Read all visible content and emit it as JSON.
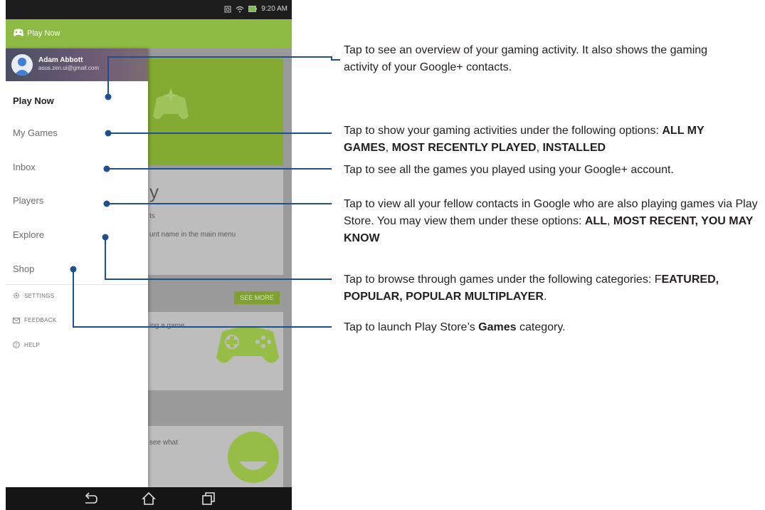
{
  "status_bar": {
    "time": "9:20 AM"
  },
  "app": {
    "title": "Play Now"
  },
  "account": {
    "name": "Adam Abbott",
    "email": "asus.zen.ui@gmail.com"
  },
  "nav": [
    {
      "label": "Play Now",
      "active": true
    },
    {
      "label": "My Games"
    },
    {
      "label": "Inbox"
    },
    {
      "label": "Players"
    },
    {
      "label": "Explore"
    },
    {
      "label": "Shop"
    }
  ],
  "secondary": [
    {
      "label": "SETTINGS",
      "icon": "gear-icon"
    },
    {
      "label": "FEEDBACK",
      "icon": "mail-icon"
    },
    {
      "label": "HELP",
      "icon": "help-icon"
    }
  ],
  "background": {
    "card_text_1": "y",
    "card_text_2": "ts",
    "card_text_3": "unt name in the main menu",
    "see_more": "SEE MORE",
    "card_text_4": "ing a game",
    "card_text_5": "see what"
  },
  "callouts": [
    {
      "parts": [
        {
          "t": "Tap to see an overview of your gaming activity. It also shows the gaming activity of your  Google+ contacts."
        }
      ]
    },
    {
      "parts": [
        {
          "t": "Tap to show your gaming activities under the following options: "
        },
        {
          "t": "ALL MY GAMES",
          "b": true
        },
        {
          "t": ", "
        },
        {
          "t": "MOST RECENTLY PLAYED",
          "b": true
        },
        {
          "t": ", "
        },
        {
          "t": "INSTALLED",
          "b": true
        }
      ]
    },
    {
      "parts": [
        {
          "t": "Tap to see all the games you played using your Google+ account."
        }
      ]
    },
    {
      "parts": [
        {
          "t": "Tap to view all your fellow contacts in Google who are also playing games via Play Store. You may view them under these options: "
        },
        {
          "t": "ALL",
          "b": true
        },
        {
          "t": ", "
        },
        {
          "t": "MOST RECENT, YOU MAY KNOW",
          "b": true
        }
      ]
    },
    {
      "parts": [
        {
          "t": "Tap to browse through games under the following categories: F"
        },
        {
          "t": "EATURED, POPULAR, POPULAR MULTIPLAYER",
          "b": true
        },
        {
          "t": "."
        }
      ]
    },
    {
      "parts": [
        {
          "t": "Tap to launch Play Store’s "
        },
        {
          "t": "Games",
          "b": true
        },
        {
          "t": " category."
        }
      ]
    }
  ],
  "colors": {
    "accent": "#8dba42",
    "callout_line": "#1f4f8c"
  }
}
